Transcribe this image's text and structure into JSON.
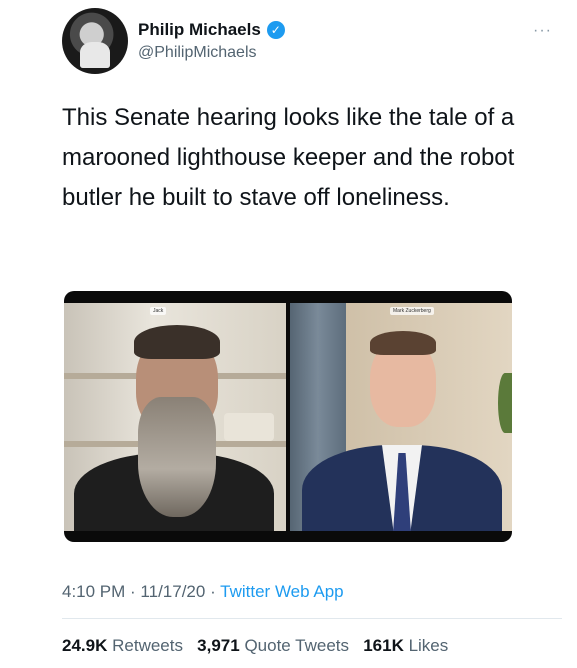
{
  "author": {
    "display_name": "Philip Michaels",
    "handle": "@PhilipMichaels",
    "verified_icon": "verified-badge-icon",
    "more_icon": "more-options-icon"
  },
  "tweet": {
    "text": "This Senate hearing looks like the tale of a marooned lighthouse keeper and the robot butler he built to stave off loneliness."
  },
  "media": {
    "left_name_tag": "Jack",
    "right_name_tag": "Mark Zuckerberg"
  },
  "meta": {
    "time": "4:10 PM",
    "separator1": " · ",
    "date": "11/17/20",
    "separator2": " · ",
    "app": "Twitter Web App"
  },
  "stats": {
    "retweets_count": "24.9K",
    "retweets_label": "Retweets",
    "quote_count": "3,971",
    "quote_label": "Quote Tweets",
    "likes_count": "161K",
    "likes_label": "Likes"
  },
  "colors": {
    "accent": "#1d9bf0",
    "secondary_text": "#536471",
    "primary_text": "#0f1419"
  }
}
